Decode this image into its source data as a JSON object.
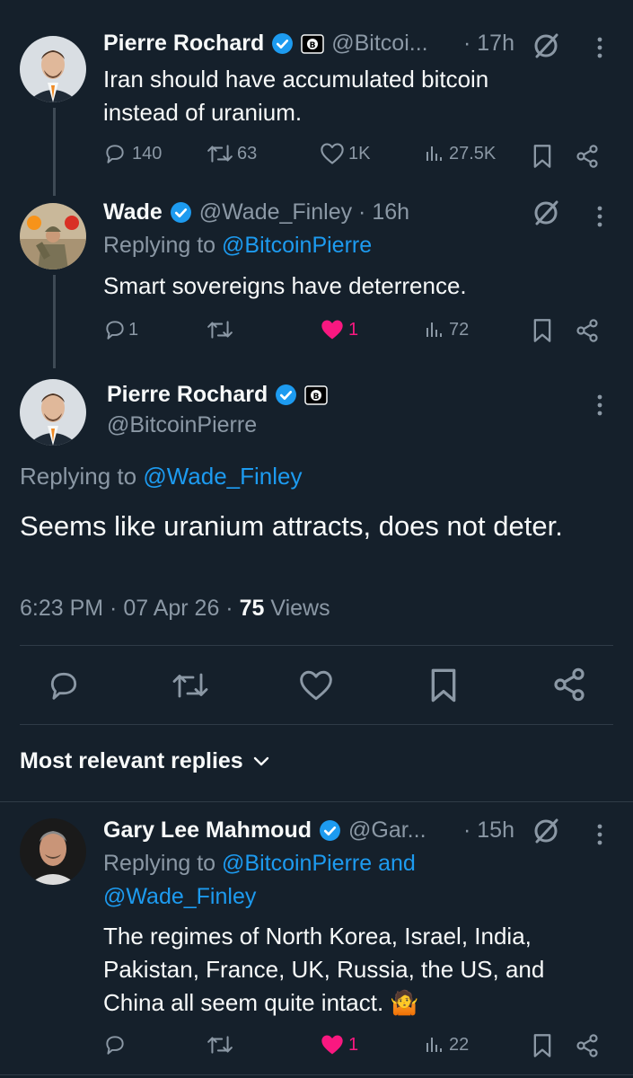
{
  "tweet1": {
    "name": "Pierre Rochard",
    "handle": "@Bitcoi...",
    "time": "· 17h",
    "text": "Iran should have accumulated bitcoin instead of uranium.",
    "replies": "140",
    "retweets": "63",
    "likes": "1K",
    "views": "27.5K"
  },
  "tweet2": {
    "name": "Wade",
    "handle": "@Wade_Finley · 16h",
    "replying_prefix": "Replying to",
    "replying_to": "@BitcoinPierre",
    "text": "Smart sovereigns have deterrence.",
    "replies": "1",
    "likes": "1",
    "views": "72"
  },
  "main_tweet": {
    "name": "Pierre Rochard",
    "handle": "@BitcoinPierre",
    "replying_prefix": "Replying to",
    "replying_to": "@Wade_Finley",
    "text": "Seems like uranium attracts, does not deter.",
    "meta_time": "6:23 PM · 07 Apr 26 ·",
    "views_count": "75",
    "views_label": "Views"
  },
  "replies_section": {
    "label": "Most relevant replies"
  },
  "tweet3": {
    "name": "Gary Lee Mahmoud",
    "handle": "@Gar...",
    "time": "· 15h",
    "replying_prefix": "Replying to",
    "replying_to_1": "@BitcoinPierre and",
    "replying_to_2": "@Wade_Finley",
    "text": "The regimes of North Korea, Israel, India, Pakistan, France, UK, Russia, the US, and China all seem quite intact.",
    "emoji": "🤷",
    "likes": "1",
    "views": "22"
  },
  "colors": {
    "background": "#15202b",
    "accent": "#1d9bf0",
    "like": "#f91880",
    "muted": "#8b98a5"
  }
}
